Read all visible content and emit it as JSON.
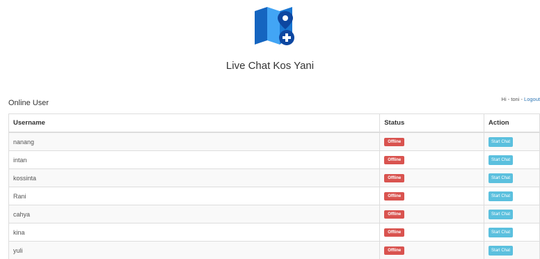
{
  "app": {
    "title": "Live Chat Kos Yani"
  },
  "header": {
    "greeting": "Hi - toni - ",
    "logout_label": "Logout"
  },
  "section": {
    "title": "Online User"
  },
  "table": {
    "columns": [
      "Username",
      "Status",
      "Action"
    ],
    "rows": [
      {
        "username": "nanang",
        "status": "Offline",
        "action": "Start Chat"
      },
      {
        "username": "intan",
        "status": "Offline",
        "action": "Start Chat"
      },
      {
        "username": "kossinta",
        "status": "Offline",
        "action": "Start Chat"
      },
      {
        "username": "Rani",
        "status": "Offline",
        "action": "Start Chat"
      },
      {
        "username": "cahya",
        "status": "Offline",
        "action": "Start Chat"
      },
      {
        "username": "kina",
        "status": "Offline",
        "action": "Start Chat"
      },
      {
        "username": "yuli",
        "status": "Offline",
        "action": "Start Chat"
      }
    ]
  },
  "colors": {
    "offline_badge": "#d9534f",
    "start_chat_button": "#5bc0de",
    "logo_dark": "#1565c0",
    "logo_light": "#42a5f5",
    "link": "#337ab7"
  },
  "icons": {
    "logo": "map-pin-plus-icon"
  }
}
